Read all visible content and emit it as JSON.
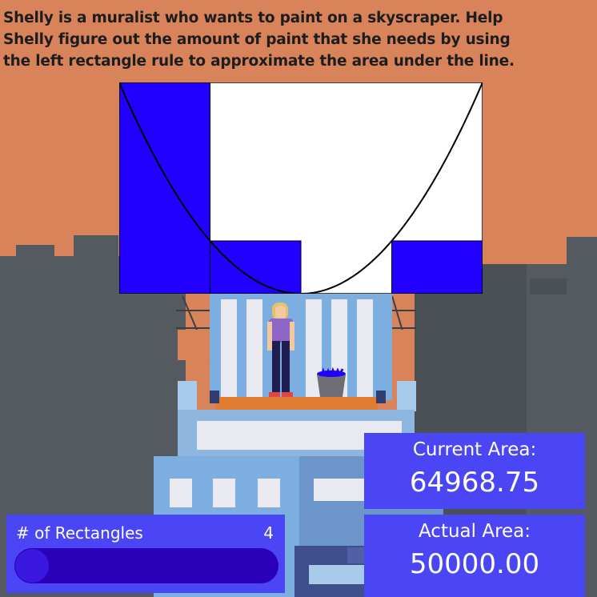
{
  "prompt": {
    "text": "Shelly is a muralist who wants to paint on a skyscraper. Help\nShelly figure out the amount of paint that she needs by using\nthe left rectangle rule to approximate the area under the line."
  },
  "area": {
    "current_label": "Current Area:",
    "current_value": "64968.75",
    "actual_label": "Actual Area:",
    "actual_value": "50000.00"
  },
  "rectangles": {
    "label": "# of Rectangles",
    "count": "4",
    "slider_fraction": 0.0
  },
  "colors": {
    "sky": "#D8835A",
    "buildings": "#545A60",
    "panel": "#4A45F5",
    "rect_fill": "#2200FF",
    "slider_track": "#2A00B8"
  }
}
